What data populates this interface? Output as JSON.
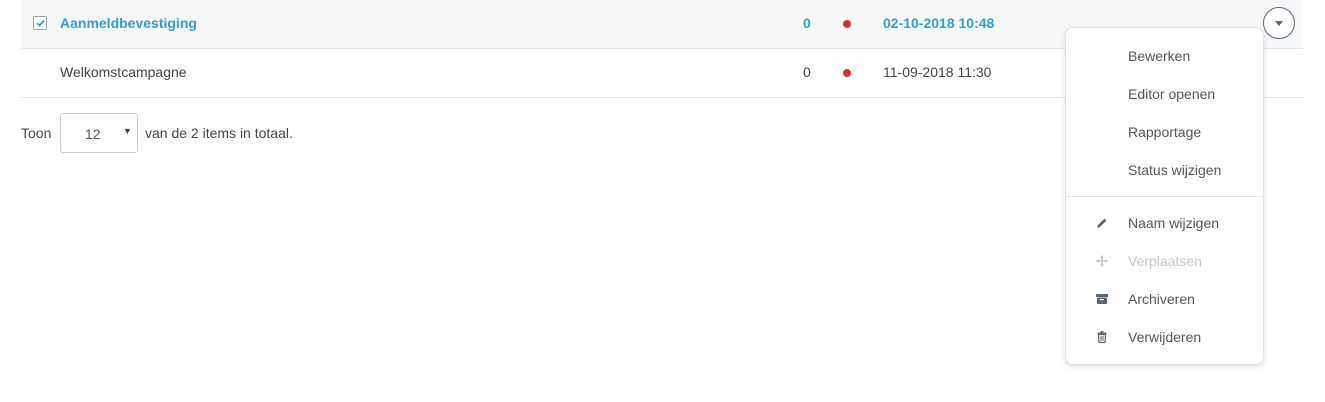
{
  "rows": [
    {
      "name": "Aanmeldbevestiging",
      "count": "0",
      "date": "02-10-2018 10:48",
      "status_color": "#d0342c",
      "selected": true
    },
    {
      "name": "Welkomstcampagne",
      "count": "0",
      "date": "11-09-2018 11:30",
      "status_color": "#d0342c",
      "selected": false
    }
  ],
  "pager": {
    "prefix": "Toon",
    "page_size": "12",
    "suffix": "van de 2 items in totaal."
  },
  "menu": {
    "items": [
      {
        "label": "Bewerken"
      },
      {
        "label": "Editor openen"
      },
      {
        "label": "Rapportage"
      },
      {
        "label": "Status wijzigen"
      },
      {
        "label": "Naam wijzigen",
        "icon": "pencil-icon"
      },
      {
        "label": "Verplaatsen",
        "icon": "move-icon",
        "disabled": true
      },
      {
        "label": "Archiveren",
        "icon": "archive-icon"
      },
      {
        "label": "Verwijderen",
        "icon": "trash-icon"
      }
    ]
  },
  "colors": {
    "accent": "#2b9fd8",
    "status_red": "#d0342c"
  }
}
